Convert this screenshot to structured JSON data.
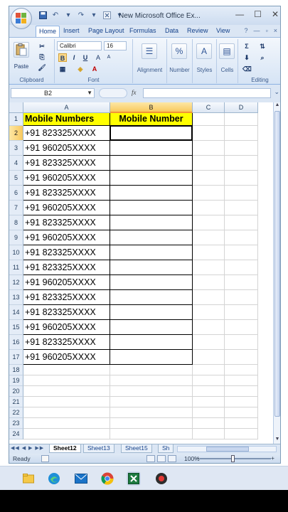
{
  "window": {
    "title": "New Microsoft Office Ex..."
  },
  "tabs": [
    "Home",
    "Insert",
    "Page Layout",
    "Formulas",
    "Data",
    "Review",
    "View"
  ],
  "ribbon": {
    "clipboard": {
      "paste": "Paste",
      "label": "Clipboard"
    },
    "font": {
      "name": "Calibri",
      "size": "16",
      "bold": "B",
      "italic": "I",
      "underline": "U",
      "label": "Font"
    },
    "alignment": "Alignment",
    "number": "Number",
    "styles": "Styles",
    "cells": "Cells",
    "editing": "Editing"
  },
  "formula_bar": {
    "name_box": "B2",
    "fx": "fx",
    "content": ""
  },
  "columns": [
    "A",
    "B",
    "C",
    "D"
  ],
  "rows": [
    "1",
    "2",
    "3",
    "4",
    "5",
    "6",
    "7",
    "8",
    "9",
    "10",
    "11",
    "12",
    "13",
    "14",
    "15",
    "16",
    "17",
    "18",
    "19",
    "20",
    "21",
    "22",
    "23",
    "24"
  ],
  "cells": {
    "A1": "Mobile Numbers",
    "B1": "Mobile Number",
    "A": [
      "+91 823325XXXX",
      "+91 960205XXXX",
      "+91 823325XXXX",
      "+91 960205XXXX",
      "+91 823325XXXX",
      "+91 960205XXXX",
      "+91 823325XXXX",
      "+91 960205XXXX",
      "+91 823325XXXX",
      "+91 823325XXXX",
      "+91 960205XXXX",
      "+91 823325XXXX",
      "+91 823325XXXX",
      "+91 960205XXXX",
      "+91 823325XXXX",
      "+91 960205XXXX"
    ]
  },
  "sheets": [
    "Sheet12",
    "Sheet13",
    "Sheet15",
    "Sh"
  ],
  "status": {
    "ready": "Ready",
    "zoom": "100%",
    "zoom_minus": "−",
    "zoom_plus": "+"
  },
  "colors": {
    "header_fill": "#ffff00",
    "selection_header": "#f8c95f",
    "ribbon": "#d6e4f5"
  },
  "taskbar_icons": [
    "file-explorer-icon",
    "edge-icon",
    "mail-icon",
    "chrome-icon",
    "excel-icon",
    "recorder-icon"
  ]
}
